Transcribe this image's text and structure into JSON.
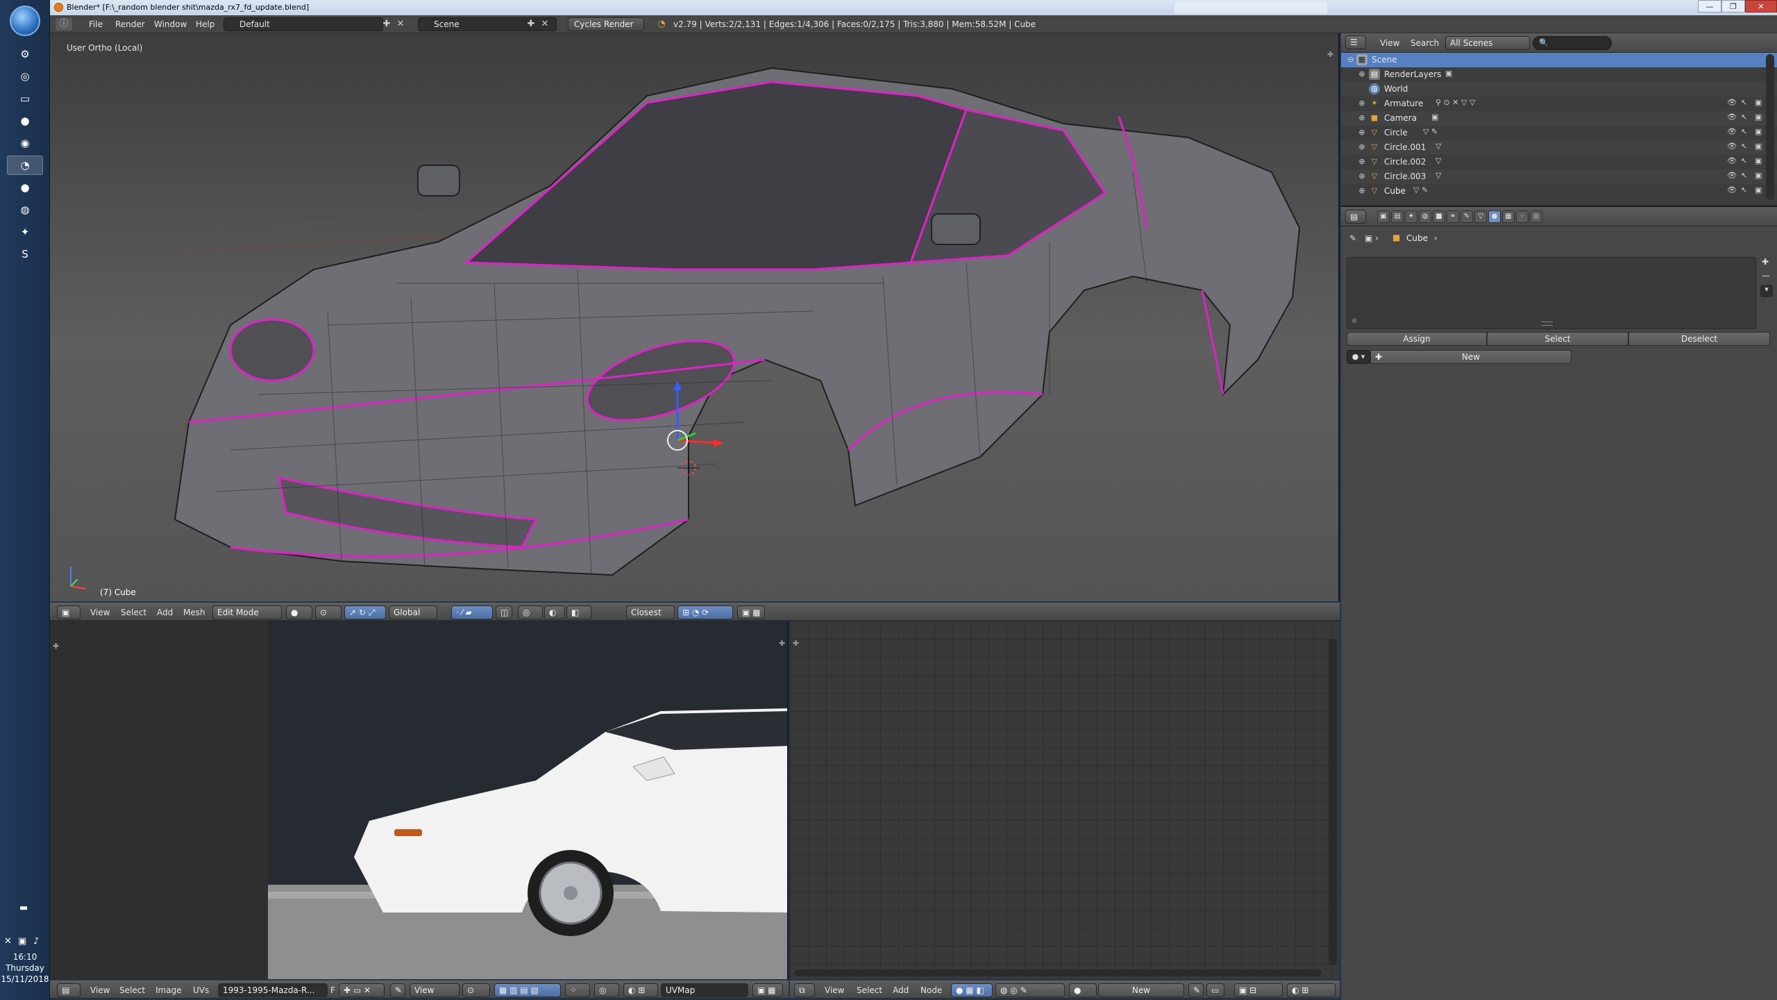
{
  "window": {
    "title": "Blender* [F:\\_random blender shit\\mazda_rx7_fd_update.blend]"
  },
  "taskbar": {
    "apps": [
      "steam-icon",
      "whatsapp-icon",
      "explorer-icon",
      "firefox-icon",
      "discord-icon",
      "blender-icon",
      "origin-icon",
      "uplay-icon",
      "gamepad-icon",
      "skype-icon"
    ],
    "clock": {
      "time": "16:10",
      "day": "Thursday",
      "date": "15/11/2018"
    }
  },
  "info_header": {
    "menus": [
      "File",
      "Render",
      "Window",
      "Help"
    ],
    "layout": "Default",
    "scene": "Scene",
    "engine": "Cycles Render",
    "stats": "v2.79 | Verts:2/2,131 | Edges:1/4,306 | Faces:0/2,175 | Tris:3,880 | Mem:58.52M | Cube"
  },
  "viewport": {
    "view_label": "User Ortho (Local)",
    "object_label": "(7) Cube",
    "header": {
      "menus": [
        "View",
        "Select",
        "Add",
        "Mesh"
      ],
      "mode": "Edit Mode",
      "orientation": "Global",
      "snap": "Closest"
    }
  },
  "image_editor": {
    "header": {
      "menus": [
        "View",
        "Select",
        "Image",
        "UVs"
      ],
      "image_name": "1993-1995-Mazda-R...",
      "image_flag": "F",
      "view_mode": "View",
      "uv_map": "UVMap"
    }
  },
  "node_editor": {
    "header": {
      "menus": [
        "View",
        "Select",
        "Add",
        "Node"
      ],
      "new_label": "New"
    }
  },
  "outliner": {
    "header": {
      "menus": [
        "View",
        "Search"
      ],
      "display": "All Scenes"
    },
    "rows": [
      {
        "label": "Scene",
        "icon": "scene-icon",
        "color": "#b0b0b0"
      },
      {
        "label": "RenderLayers",
        "icon": "renderlayers-icon",
        "color": "#9a9a9a"
      },
      {
        "label": "World",
        "icon": "world-icon",
        "color": "#8aa7d0"
      },
      {
        "label": "Armature",
        "icon": "armature-icon",
        "color": "#e3a43c"
      },
      {
        "label": "Camera",
        "icon": "camera-icon",
        "color": "#e3a43c"
      },
      {
        "label": "Circle",
        "icon": "mesh-icon",
        "color": "#e3a43c"
      },
      {
        "label": "Circle.001",
        "icon": "mesh-icon",
        "color": "#e3a43c"
      },
      {
        "label": "Circle.002",
        "icon": "mesh-icon",
        "color": "#e3a43c"
      },
      {
        "label": "Circle.003",
        "icon": "mesh-icon",
        "color": "#e3a43c"
      },
      {
        "label": "Cube",
        "icon": "mesh-icon",
        "color": "#e3a43c"
      }
    ]
  },
  "properties": {
    "breadcrumb_object": "Cube",
    "buttons": {
      "assign": "Assign",
      "select": "Select",
      "deselect": "Deselect",
      "new": "New"
    }
  },
  "colors": {
    "accent": "#5680c2",
    "edge_seam": "#e020c8",
    "viewport_bg": "#4a4a4a"
  }
}
